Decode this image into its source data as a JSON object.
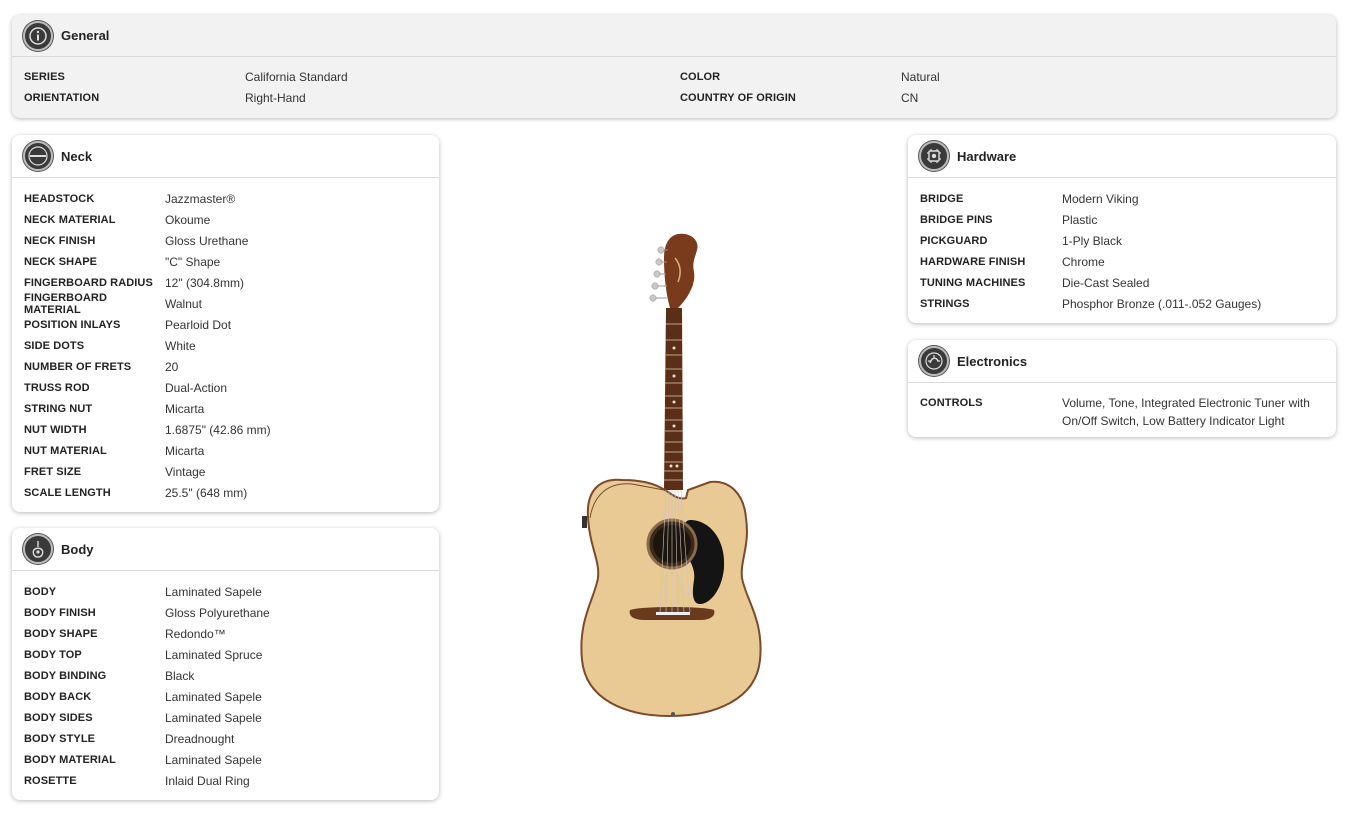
{
  "general": {
    "title": "General",
    "icon": "info-icon",
    "rows": [
      {
        "label1": "SERIES",
        "value1": "California Standard",
        "label2": "COLOR",
        "value2": "Natural"
      },
      {
        "label1": "ORIENTATION",
        "value1": "Right-Hand",
        "label2": "COUNTRY OF ORIGIN",
        "value2": "CN"
      }
    ]
  },
  "neck": {
    "title": "Neck",
    "icon": "neck-icon",
    "rows": [
      {
        "label": "HEADSTOCK",
        "value": "Jazzmaster®"
      },
      {
        "label": "NECK MATERIAL",
        "value": "Okoume"
      },
      {
        "label": "NECK FINISH",
        "value": "Gloss Urethane"
      },
      {
        "label": "NECK SHAPE",
        "value": "\"C\" Shape"
      },
      {
        "label": "FINGERBOARD RADIUS",
        "value": "12\" (304.8mm)"
      },
      {
        "label": "FINGERBOARD MATERIAL",
        "value": "Walnut"
      },
      {
        "label": "POSITION INLAYS",
        "value": "Pearloid Dot"
      },
      {
        "label": "SIDE DOTS",
        "value": "White"
      },
      {
        "label": "NUMBER OF FRETS",
        "value": "20"
      },
      {
        "label": "TRUSS ROD",
        "value": "Dual-Action"
      },
      {
        "label": "STRING NUT",
        "value": "Micarta"
      },
      {
        "label": "NUT WIDTH",
        "value": "1.6875\" (42.86 mm)"
      },
      {
        "label": "NUT MATERIAL",
        "value": "Micarta"
      },
      {
        "label": "FRET SIZE",
        "value": "Vintage"
      },
      {
        "label": "SCALE LENGTH",
        "value": "25.5\" (648 mm)"
      }
    ]
  },
  "body": {
    "title": "Body",
    "icon": "guitar-body-icon",
    "rows": [
      {
        "label": "BODY",
        "value": "Laminated Sapele"
      },
      {
        "label": "BODY FINISH",
        "value": "Gloss Polyurethane"
      },
      {
        "label": "BODY SHAPE",
        "value": "Redondo™"
      },
      {
        "label": "BODY TOP",
        "value": "Laminated Spruce"
      },
      {
        "label": "BODY BINDING",
        "value": "Black"
      },
      {
        "label": "BODY BACK",
        "value": "Laminated Sapele"
      },
      {
        "label": "BODY SIDES",
        "value": "Laminated Sapele"
      },
      {
        "label": "BODY STYLE",
        "value": "Dreadnought"
      },
      {
        "label": "BODY MATERIAL",
        "value": "Laminated Sapele"
      },
      {
        "label": "ROSETTE",
        "value": "Inlaid Dual Ring"
      }
    ]
  },
  "hardware": {
    "title": "Hardware",
    "icon": "hardware-icon",
    "rows": [
      {
        "label": "BRIDGE",
        "value": "Modern Viking"
      },
      {
        "label": "BRIDGE PINS",
        "value": "Plastic"
      },
      {
        "label": "PICKGUARD",
        "value": "1-Ply Black"
      },
      {
        "label": "HARDWARE FINISH",
        "value": "Chrome"
      },
      {
        "label": "TUNING MACHINES",
        "value": "Die-Cast Sealed"
      },
      {
        "label": "STRINGS",
        "value": "Phosphor Bronze (.011-.052 Gauges)"
      }
    ]
  },
  "electronics": {
    "title": "Electronics",
    "icon": "electronics-icon",
    "rows": [
      {
        "label": "CONTROLS",
        "value": "Volume, Tone, Integrated Electronic Tuner with On/Off Switch, Low Battery Indicator Light"
      }
    ]
  },
  "product_image": {
    "icon": "acoustic-guitar-image"
  },
  "colors": {
    "card_bg": "#ffffff",
    "general_bg": "#f2f2f2",
    "icon_badge": "#3a3a3a"
  }
}
